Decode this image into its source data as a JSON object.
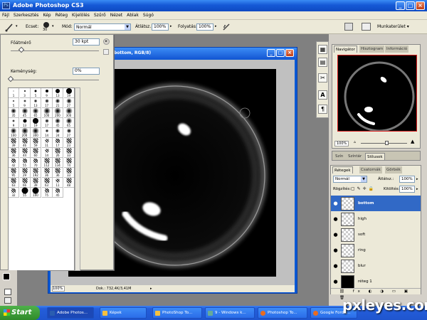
{
  "window": {
    "title": "Adobe Photoshop CS3",
    "app_icon": "Ps"
  },
  "menu": [
    "Fájl",
    "Szerkesztés",
    "Kép",
    "Réteg",
    "Kijelölés",
    "Szűrő",
    "Nézet",
    "Ablak",
    "Súgó"
  ],
  "options": {
    "brush_label": "Ecset:",
    "brush_size": "30",
    "mode_label": "Mód:",
    "mode_value": "Normál",
    "opacity_label": "Átlátsz.:",
    "opacity_value": "100%",
    "flow_label": "Folyatás:",
    "flow_value": "100%",
    "workspace_label": "Munkaterület ▾"
  },
  "brush_picker": {
    "diameter_label": "Főátmérő",
    "diameter_value": "30 kpt",
    "hardness_label": "Keménység:",
    "hardness_value": "0%",
    "diameter_fraction": 0.12,
    "hardness_fraction": 0.0,
    "brushes": [
      {
        "l": "1",
        "s": 1
      },
      {
        "l": "3",
        "s": 2
      },
      {
        "l": "5",
        "s": 3
      },
      {
        "l": "9",
        "s": 4
      },
      {
        "l": "13",
        "s": 6
      },
      {
        "l": "19",
        "s": 8
      },
      {
        "l": "5",
        "s": 3,
        "soft": 1
      },
      {
        "l": "9",
        "s": 4,
        "soft": 1
      },
      {
        "l": "13",
        "s": 5,
        "soft": 1
      },
      {
        "l": "17",
        "s": 6,
        "soft": 1
      },
      {
        "l": "21",
        "s": 7,
        "soft": 1
      },
      {
        "l": "27",
        "s": 8,
        "soft": 1
      },
      {
        "l": "35",
        "s": 8,
        "soft": 1
      },
      {
        "l": "45",
        "s": 9,
        "soft": 1
      },
      {
        "l": "65",
        "s": 9,
        "soft": 1
      },
      {
        "l": "100",
        "s": 10,
        "soft": 1
      },
      {
        "l": "200",
        "s": 10,
        "soft": 1
      },
      {
        "l": "300",
        "s": 10,
        "soft": 1
      },
      {
        "l": "9",
        "s": 4,
        "soft": 1
      },
      {
        "l": "13",
        "s": 5
      },
      {
        "l": "19",
        "s": 8
      },
      {
        "l": "17",
        "s": 6,
        "soft": 1
      },
      {
        "l": "45",
        "s": 8,
        "soft": 1
      },
      {
        "l": "65",
        "s": 9,
        "soft": 1
      },
      {
        "l": "100",
        "s": 9,
        "soft": 1
      },
      {
        "l": "200",
        "s": 10,
        "soft": 1
      },
      {
        "l": "300",
        "s": 10,
        "soft": 1
      },
      {
        "l": "14",
        "s": 5,
        "soft": 1
      },
      {
        "l": "24",
        "s": 7,
        "soft": 1
      },
      {
        "l": "27",
        "s": 7,
        "soft": 1
      },
      {
        "l": "39",
        "s": 7,
        "tex": 1
      },
      {
        "l": "46",
        "s": 7,
        "tex": 1
      },
      {
        "l": "59",
        "s": 7,
        "tex": 1
      },
      {
        "l": "11",
        "s": 5,
        "tex": 1
      },
      {
        "l": "17",
        "s": 6,
        "tex": 1
      },
      {
        "l": "23",
        "s": 7,
        "tex": 1
      },
      {
        "l": "36",
        "s": 7,
        "tex": 1
      },
      {
        "l": "44",
        "s": 7,
        "tex": 1
      },
      {
        "l": "60",
        "s": 7,
        "tex": 1
      },
      {
        "l": "14",
        "s": 5,
        "tex": 1
      },
      {
        "l": "26",
        "s": 7,
        "tex": 1
      },
      {
        "l": "33",
        "s": 7,
        "tex": 1
      },
      {
        "l": "42",
        "s": 6,
        "tex": 1
      },
      {
        "l": "55",
        "s": 6,
        "tex": 1
      },
      {
        "l": "70",
        "s": 6,
        "tex": 1
      },
      {
        "l": "112",
        "s": 7,
        "tex": 1
      },
      {
        "l": "134",
        "s": 7,
        "tex": 1
      },
      {
        "l": "74",
        "s": 7,
        "tex": 1
      },
      {
        "l": "95",
        "s": 7,
        "tex": 1
      },
      {
        "l": "29",
        "s": 7,
        "tex": 1
      },
      {
        "l": "192",
        "s": 7,
        "tex": 1
      },
      {
        "l": "36",
        "s": 7,
        "tex": 1
      },
      {
        "l": "36",
        "s": 7,
        "tex": 1
      },
      {
        "l": "33",
        "s": 7,
        "tex": 1
      },
      {
        "l": "63",
        "s": 7,
        "tex": 1
      },
      {
        "l": "66",
        "s": 7,
        "tex": 1
      },
      {
        "l": "39",
        "s": 7,
        "tex": 1
      },
      {
        "l": "63",
        "s": 7,
        "tex": 1
      },
      {
        "l": "11",
        "s": 5,
        "tex": 1
      },
      {
        "l": "48",
        "s": 7,
        "tex": 1
      },
      {
        "l": "32",
        "s": 6,
        "tex": 1
      },
      {
        "l": "55",
        "s": 9
      },
      {
        "l": "100",
        "s": 9
      },
      {
        "l": "75",
        "s": 6,
        "tex": 1
      },
      {
        "l": "45",
        "s": 6,
        "tex": 1
      }
    ]
  },
  "document": {
    "title": "bottom, RGB/8)",
    "zoom": "100%",
    "doc_info": "Dok.: 732,4K/3,41M"
  },
  "navigator": {
    "tabs": [
      "Navigátor",
      "Hisztogram",
      "Információ"
    ],
    "zoom": "100%"
  },
  "color_tabs": [
    "Szín",
    "Színtár",
    "Stílusok"
  ],
  "layers_panel": {
    "tabs": [
      "Rétegek",
      "Csatornák",
      "Görbék"
    ],
    "blend_mode": "Normál",
    "opacity_label": "Átlátsz.:",
    "opacity_value": "100%",
    "lock_label": "Rögzítés:",
    "fill_label": "Kitöltés:",
    "fill_value": "100%",
    "layers": [
      {
        "name": "bottom",
        "selected": true,
        "black": false
      },
      {
        "name": "high",
        "selected": false,
        "black": false
      },
      {
        "name": "soft",
        "selected": false,
        "black": false
      },
      {
        "name": "ring",
        "selected": false,
        "black": false
      },
      {
        "name": "blur",
        "selected": false,
        "black": false
      },
      {
        "name": "réteg 1",
        "selected": false,
        "black": true
      }
    ]
  },
  "taskbar": {
    "start": "Start",
    "tasks": [
      "Adobe Photos...",
      "Képek",
      "PhotoShop To...",
      "9 - Windows k...",
      "Photoshop To...",
      "Google Fordít..."
    ]
  },
  "watermark": "pxleyes.com"
}
